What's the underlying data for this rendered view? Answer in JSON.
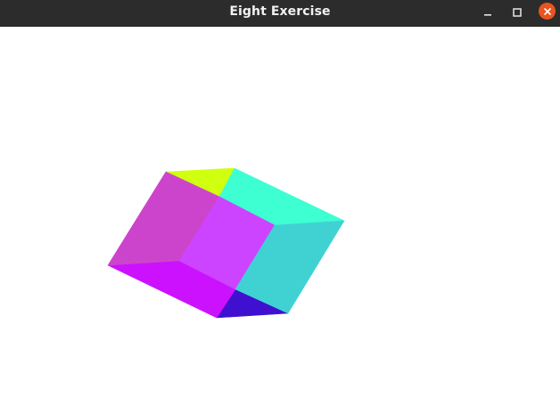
{
  "window": {
    "title": "Eight Exercise",
    "controls": {
      "minimize_icon": "minimize-icon",
      "maximize_icon": "maximize-icon",
      "close_icon": "close-icon"
    }
  },
  "scene": {
    "object": "cube",
    "colors": {
      "titlebar": "#2c2c2c",
      "close_button": "#e95420",
      "top_left": "#d0ff0f",
      "top_right": "#3effd2",
      "back_left": "#cc44cc",
      "front": "#cc44ff",
      "right": "#40d2d2",
      "bottom_left": "#cc11ff",
      "bottom_right": "#4010d0"
    }
  }
}
